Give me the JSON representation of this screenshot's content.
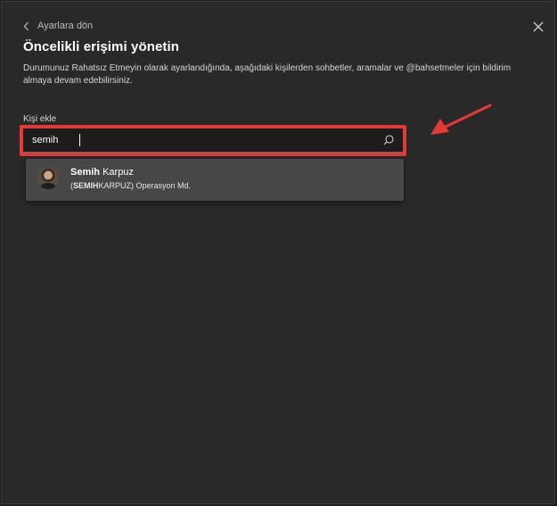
{
  "header": {
    "back_label": "Ayarlara dön",
    "title": "Öncelikli erişimi yönetin",
    "description": "Durumunuz Rahatsız Etmeyin olarak ayarlandığında, aşağıdaki kişilerden sohbetler, aramalar ve @bahsetmeler için bildirim almaya devam edebilirsiniz."
  },
  "add_person": {
    "label": "Kişi ekle",
    "value": "semih",
    "placeholder": ""
  },
  "results": [
    {
      "name_match": "Semih",
      "name_rest": " Karpuz",
      "sub_open": "(",
      "sub_match": "SEMIH",
      "sub_rest": "KARPUZ) Operasyon Md."
    }
  ],
  "icons": {
    "back": "chevron-left-icon",
    "close": "close-icon",
    "search": "search-icon"
  },
  "colors": {
    "background": "#292929",
    "highlight": "#e53935",
    "dropdown": "#474747"
  }
}
